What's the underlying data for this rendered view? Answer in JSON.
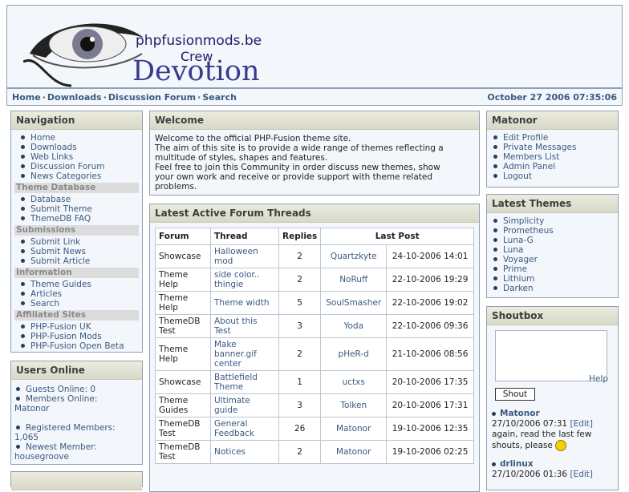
{
  "header": {
    "site": "phpfusionmods.be",
    "crew": "Crew",
    "devotion": "Devotion"
  },
  "navbar": {
    "links": [
      "Home",
      "Downloads",
      "Discussion Forum",
      "Search"
    ],
    "separator": "·",
    "date": "October 27 2006 07:35:06"
  },
  "navigation": {
    "title": "Navigation",
    "main": [
      "Home",
      "Downloads",
      "Web Links",
      "Discussion Forum",
      "News Categories"
    ],
    "sections": [
      {
        "heading": "Theme Database",
        "items": [
          "Database",
          "Submit Theme",
          "ThemeDB FAQ"
        ]
      },
      {
        "heading": "Submissions",
        "items": [
          "Submit Link",
          "Submit News",
          "Submit Article"
        ]
      },
      {
        "heading": "Information",
        "items": [
          "Theme Guides",
          "Articles",
          "Search"
        ]
      },
      {
        "heading": "Affiliated Sites",
        "items": [
          "PHP-Fusion UK",
          "PHP-Fusion Mods",
          "PHP-Fusion Open Beta"
        ]
      }
    ]
  },
  "users_online": {
    "title": "Users Online",
    "guests": "Guests Online: 0",
    "members": "Members Online:",
    "member_name": "Matonor",
    "registered": "Registered Members:",
    "registered_count": "1,065",
    "newest": "Newest Member:",
    "newest_name": "housegroove"
  },
  "welcome": {
    "title": "Welcome",
    "lines": [
      "Welcome to the official PHP-Fusion theme site.",
      "The aim of this site is to provide a wide range of themes reflecting a",
      "multitude of styles, shapes and features.",
      "Feel free to join this Community in order discuss new themes, show",
      "your own work and receive or provide support with theme related",
      "problems."
    ]
  },
  "forum_threads": {
    "title": "Latest Active Forum Threads",
    "headers": [
      "Forum",
      "Thread",
      "Replies",
      "Last Post"
    ],
    "rows": [
      {
        "forum": [
          "Showcase"
        ],
        "thread": [
          "Halloween",
          "mod"
        ],
        "replies": "2",
        "user": "Quartzkyte",
        "date": "24-10-2006 14:01"
      },
      {
        "forum": [
          "Theme",
          "Help"
        ],
        "thread": [
          "side color..",
          "thingie"
        ],
        "replies": "2",
        "user": "NoRuff",
        "date": "22-10-2006 19:29"
      },
      {
        "forum": [
          "Theme",
          "Help"
        ],
        "thread": [
          "Theme width"
        ],
        "replies": "5",
        "user": "SoulSmasher",
        "date": "22-10-2006 19:02"
      },
      {
        "forum": [
          "ThemeDB",
          "Test"
        ],
        "thread": [
          "About this",
          "Test"
        ],
        "replies": "3",
        "user": "Yoda",
        "date": "22-10-2006 09:36"
      },
      {
        "forum": [
          "Theme",
          "Help"
        ],
        "thread": [
          "Make",
          "banner.gif",
          "center"
        ],
        "replies": "2",
        "user": "pHeR-d",
        "date": "21-10-2006 08:56"
      },
      {
        "forum": [
          "Showcase"
        ],
        "thread": [
          "Battlefield",
          "Theme"
        ],
        "replies": "1",
        "user": "uctxs",
        "date": "20-10-2006 17:35"
      },
      {
        "forum": [
          "Theme",
          "Guides"
        ],
        "thread": [
          "Ultimate",
          "guide"
        ],
        "replies": "3",
        "user": "Tolken",
        "date": "20-10-2006 17:31"
      },
      {
        "forum": [
          "ThemeDB",
          "Test"
        ],
        "thread": [
          "General",
          "Feedback"
        ],
        "replies": "26",
        "user": "Matonor",
        "date": "19-10-2006 12:35"
      },
      {
        "forum": [
          "ThemeDB",
          "Test"
        ],
        "thread": [
          "Notices"
        ],
        "replies": "2",
        "user": "Matonor",
        "date": "19-10-2006 02:25"
      }
    ]
  },
  "user_panel": {
    "title": "Matonor",
    "items": [
      "Edit Profile",
      "Private Messages",
      "Members List",
      "Admin Panel",
      "Logout"
    ]
  },
  "latest_themes": {
    "title": "Latest Themes",
    "items": [
      "Simplicity",
      "Prometheus",
      "Luna-G",
      "Luna",
      "Voyager",
      "Prime",
      "Lithium",
      "Darken"
    ]
  },
  "shoutbox": {
    "title": "Shoutbox",
    "button": "Shout",
    "help": "Help",
    "entries": [
      {
        "name": "Matonor",
        "time": "27/10/2006 07:31",
        "edit": "[Edit]",
        "text": [
          "again, read the last few",
          "shouts, please"
        ]
      },
      {
        "name": "drlinux",
        "time": "27/10/2006 01:36",
        "edit": "[Edit]",
        "text": []
      }
    ]
  },
  "colors": {
    "link": "#3a5a82",
    "panel_bg": "#f3f6fa",
    "border": "#8fa0b7",
    "title_bg": "#d8d8c8"
  }
}
